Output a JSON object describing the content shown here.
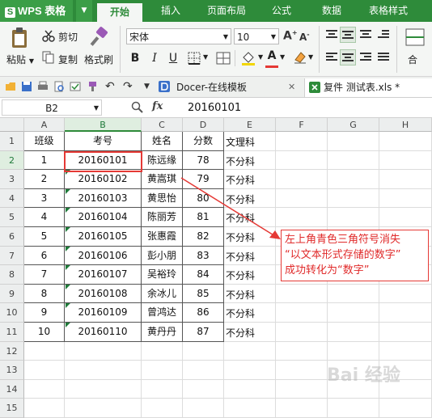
{
  "app": {
    "logo": "WPS 表格",
    "logo_letter": "S"
  },
  "menu_tabs": [
    "开始",
    "插入",
    "页面布局",
    "公式",
    "数据",
    "表格样式"
  ],
  "ribbon": {
    "paste": "粘贴",
    "cut": "剪切",
    "copy": "复制",
    "format_painter": "格式刷",
    "font_name": "宋体",
    "font_size": "10",
    "bold": "B",
    "italic": "I",
    "underline": "U",
    "font_color_glyph": "A",
    "grow_font": "A",
    "merge_label": "合"
  },
  "doc_tabs": {
    "template": "Docer-在线模板",
    "file": "复件 测试表.xls *"
  },
  "formula_bar": {
    "name_box": "B2",
    "fx": "fx",
    "value": "20160101"
  },
  "columns": [
    "A",
    "B",
    "C",
    "D",
    "E",
    "F",
    "G",
    "H"
  ],
  "rows": [
    "1",
    "2",
    "3",
    "4",
    "5",
    "6",
    "7",
    "8",
    "9",
    "10",
    "11",
    "12",
    "13",
    "14",
    "15"
  ],
  "headers": {
    "a": "班级",
    "b": "考号",
    "c": "姓名",
    "d": "分数",
    "e": "文理科"
  },
  "table": [
    {
      "a": "1",
      "b": "20160101",
      "c": "陈远缘",
      "d": "78",
      "e": "不分科"
    },
    {
      "a": "2",
      "b": "20160102",
      "c": "黄嵩琪",
      "d": "79",
      "e": "不分科"
    },
    {
      "a": "3",
      "b": "20160103",
      "c": "黄思怡",
      "d": "80",
      "e": "不分科"
    },
    {
      "a": "4",
      "b": "20160104",
      "c": "陈丽芳",
      "d": "81",
      "e": "不分科"
    },
    {
      "a": "5",
      "b": "20160105",
      "c": "张惠霞",
      "d": "82",
      "e": "不分科"
    },
    {
      "a": "6",
      "b": "20160106",
      "c": "彭小朋",
      "d": "83",
      "e": "不分科"
    },
    {
      "a": "7",
      "b": "20160107",
      "c": "吴裕玲",
      "d": "84",
      "e": "不分科"
    },
    {
      "a": "8",
      "b": "20160108",
      "c": "余冰儿",
      "d": "85",
      "e": "不分科"
    },
    {
      "a": "9",
      "b": "20160109",
      "c": "曾鸿达",
      "d": "86",
      "e": "不分科"
    },
    {
      "a": "10",
      "b": "20160110",
      "c": "黄丹丹",
      "d": "87",
      "e": "不分科"
    }
  ],
  "callout": {
    "line1": "左上角青色三角符号消失",
    "line2": "“以文本形式存储的数字”",
    "line3": "成功转化为“数字”"
  },
  "watermark": "Bai 经验",
  "colors": {
    "accent": "#2e8b3a",
    "annotation": "#e53935"
  }
}
